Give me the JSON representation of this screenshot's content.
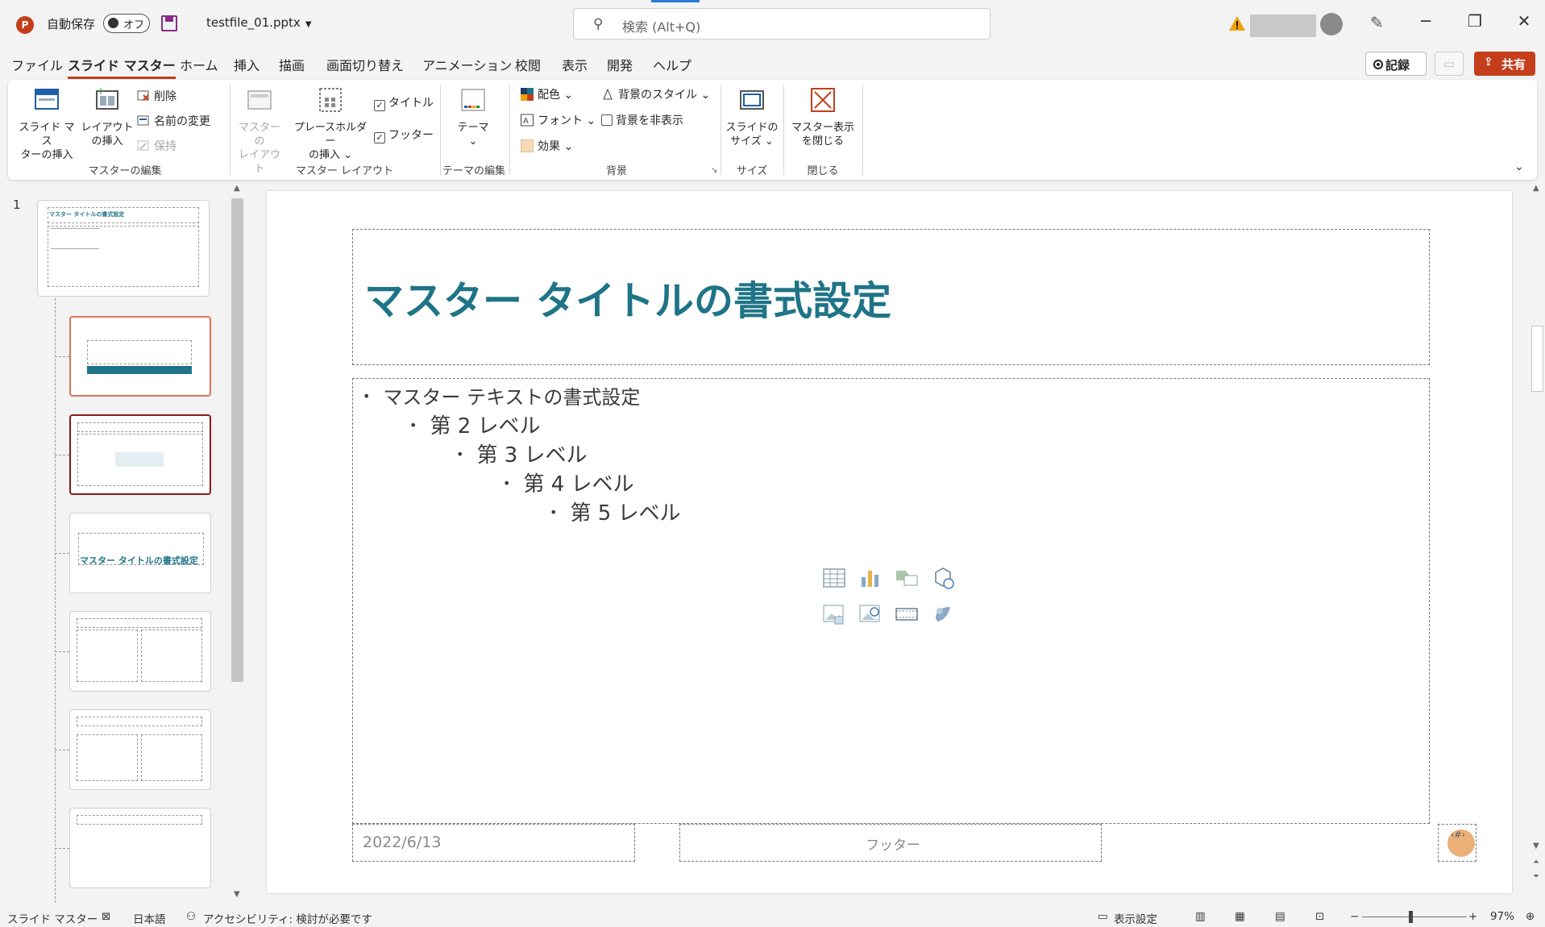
{
  "titlebar": {
    "app_letter": "P",
    "autosave_label": "自動保存",
    "autosave_state": "オフ",
    "filename": "testfile_01.pptx",
    "search_placeholder": "検索 (Alt+Q)",
    "minimize": "─",
    "restore": "❐",
    "close": "✕"
  },
  "menu": {
    "tabs": [
      "ファイル",
      "スライド マスター",
      "ホーム",
      "挿入",
      "描画",
      "画面切り替え",
      "アニメーション",
      "校閲",
      "表示",
      "開発",
      "ヘルプ"
    ],
    "active_index": 1,
    "record_label": "記録",
    "share_label": "共有"
  },
  "ribbon": {
    "groups": {
      "master_edit": "マスターの編集",
      "master_layout": "マスター レイアウト",
      "theme_edit": "テーマの編集",
      "background": "背景",
      "size": "サイズ",
      "close": "閉じる"
    },
    "insert_slide_master": [
      "スライド マス",
      "ターの挿入"
    ],
    "insert_layout": [
      "レイアウト",
      "の挿入"
    ],
    "delete": "削除",
    "rename": "名前の変更",
    "preserve": "保持",
    "master_layout_btn": [
      "マスターの",
      "レイアウト"
    ],
    "insert_placeholder": [
      "プレースホルダー",
      "の挿入 ⌄"
    ],
    "title_check": "タイトル",
    "footer_check": "フッター",
    "themes": [
      "テーマ",
      "⌄"
    ],
    "colors": "配色 ⌄",
    "fonts": "フォント ⌄",
    "effects": "効果 ⌄",
    "bg_styles": "背景のスタイル ⌄",
    "hide_bg": "背景を非表示",
    "slide_size": [
      "スライドの",
      "サイズ ⌄"
    ],
    "close_master": [
      "マスター表示",
      "を閉じる"
    ]
  },
  "thumbnails": {
    "slide_number": "1",
    "master_title": "マスター タイトルの書式設定",
    "section_title": "マスター タイトルの書式設定"
  },
  "slide": {
    "title": "マスター タイトルの書式設定",
    "bullets": [
      {
        "level": 1,
        "text": "マスター テキストの書式設定"
      },
      {
        "level": 2,
        "text": "第 2 レベル"
      },
      {
        "level": 3,
        "text": "第 3 レベル"
      },
      {
        "level": 4,
        "text": "第 4 レベル"
      },
      {
        "level": 5,
        "text": "第 5 レベル"
      }
    ],
    "date": "2022/6/13",
    "footer": "フッター",
    "page_number": "‹#›"
  },
  "statusbar": {
    "view_name": "スライド マスター",
    "language": "日本語",
    "accessibility": "アクセシビリティ: 検討が必要です",
    "display_settings": "表示設定",
    "zoom_minus": "−",
    "zoom_plus": "+",
    "zoom": "97%"
  },
  "colors": {
    "accent": "#c43e1c",
    "title_teal": "#1f7487",
    "selected_thumb": "#8b1a1a",
    "hover_thumb": "#e0735a"
  }
}
